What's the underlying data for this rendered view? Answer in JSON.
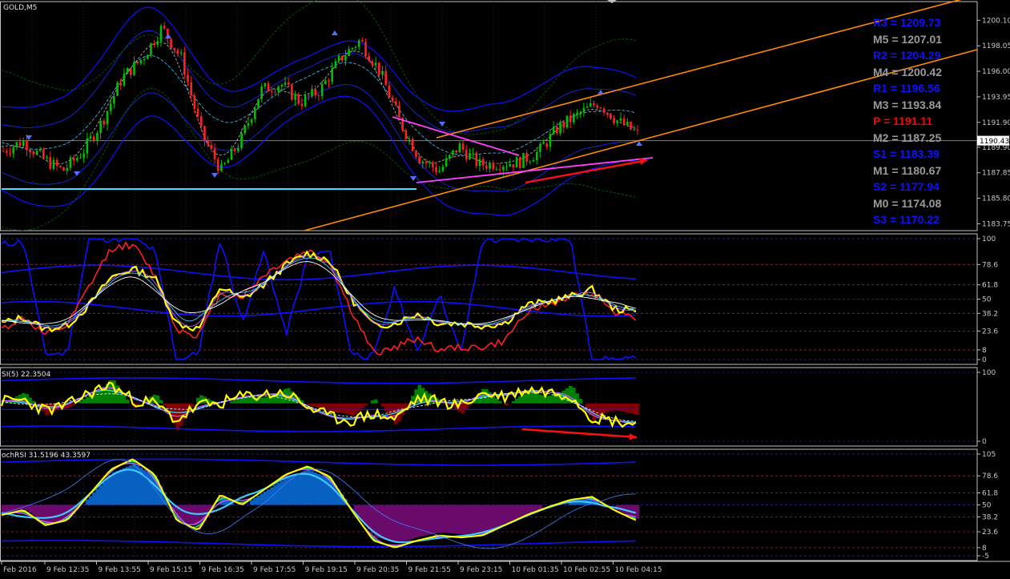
{
  "window": {
    "title": "GOLD,M5"
  },
  "colors": {
    "background": "#000000",
    "frame": "#c0c0c0",
    "bull": "#00c000",
    "bear": "#ff2020",
    "trend": "#ff8c00",
    "magenta": "#ff40ff",
    "blue": "#1010ff",
    "yellow": "#ffff00",
    "cyan": "#40c8ff",
    "histGreen": "#008000",
    "histRed": "#800000",
    "histBlue": "#0860c0",
    "histPurple": "#6a0a6a",
    "pivotBlue": "#1010ff",
    "pivotGray": "#9a9a9a",
    "pivotRed": "#ff0000"
  },
  "chart_data": [
    {
      "type": "candlestick",
      "symbol": "GOLD",
      "timeframe": "M5",
      "x_labels": [
        "Feb 2016",
        "9 Feb 12:35",
        "9 Feb 13:55",
        "9 Feb 15:15",
        "9 Feb 16:35",
        "9 Feb 17:55",
        "9 Feb 19:15",
        "9 Feb 20:35",
        "9 Feb 21:55",
        "9 Feb 23:15",
        "10 Feb 01:35",
        "10 Feb 02:55",
        "10 Feb 04:15"
      ],
      "price_scale_ticks": [
        "1200.10",
        "1198.05",
        "1196.00",
        "1193.95",
        "1191.90",
        "1189.90",
        "1187.85",
        "1185.80",
        "1183.75"
      ],
      "ylim": [
        1183.2,
        1201.6
      ],
      "current_price": "1190.43",
      "close_path": [
        1189.6,
        1190.4,
        1189.0,
        1188.0,
        1189.5,
        1192.0,
        1195.5,
        1197.0,
        1199.5,
        1197.0,
        1191.0,
        1188.0,
        1190.5,
        1194.5,
        1195.0,
        1193.5,
        1194.5,
        1197.0,
        1198.5,
        1196.0,
        1192.0,
        1189.0,
        1188.0,
        1190.0,
        1188.5,
        1188.6,
        1188.7,
        1189.5,
        1191.5,
        1192.5,
        1193.5,
        1192.0,
        1191.0
      ],
      "pivot_levels": [
        {
          "label": "R3 = 1209.73",
          "color": "#1010ff"
        },
        {
          "label": "M5 = 1207.01",
          "color": "#9a9a9a"
        },
        {
          "label": "R2 = 1204.29",
          "color": "#1010ff"
        },
        {
          "label": "M4 = 1200.42",
          "color": "#9a9a9a"
        },
        {
          "label": "R1 = 1196.56",
          "color": "#1010ff"
        },
        {
          "label": "M3 = 1193.84",
          "color": "#9a9a9a"
        },
        {
          "label": "P   = 1191.11",
          "color": "#ff0000"
        },
        {
          "label": "M2 = 1187.25",
          "color": "#9a9a9a"
        },
        {
          "label": "S1 = 1183.39",
          "color": "#1010ff"
        },
        {
          "label": "M1 = 1180.67",
          "color": "#9a9a9a"
        },
        {
          "label": "S2 = 1177.94",
          "color": "#1010ff"
        },
        {
          "label": "M0 = 1174.08",
          "color": "#9a9a9a"
        },
        {
          "label": "S3 = 1170.22",
          "color": "#1010ff"
        }
      ]
    },
    {
      "type": "line",
      "panel": "oscillator-1",
      "ylim": [
        0,
        100
      ],
      "levels": [
        "100",
        "78.6",
        "61.8",
        "50",
        "38.2",
        "23.6",
        "8",
        "0"
      ],
      "series": [
        {
          "color": "#ffff00",
          "values": [
            30,
            35,
            25,
            28,
            45,
            68,
            75,
            68,
            30,
            25,
            60,
            50,
            62,
            78,
            88,
            82,
            50,
            28,
            30,
            38,
            30,
            30,
            28,
            30,
            45,
            48,
            52,
            58,
            42,
            40
          ]
        },
        {
          "color": "#ff2020",
          "values": [
            25,
            35,
            20,
            28,
            60,
            92,
            95,
            70,
            25,
            20,
            55,
            52,
            70,
            82,
            90,
            80,
            40,
            5,
            10,
            18,
            8,
            10,
            10,
            15,
            40,
            45,
            52,
            56,
            40,
            35
          ]
        },
        {
          "color": "#1010ff",
          "values": [
            95,
            98,
            5,
            5,
            100,
            100,
            100,
            90,
            0,
            5,
            100,
            30,
            90,
            20,
            85,
            90,
            5,
            2,
            60,
            5,
            55,
            5,
            100,
            98,
            100,
            100,
            100,
            0,
            0,
            0
          ]
        }
      ]
    },
    {
      "type": "line",
      "panel": "rsi",
      "label": "SI(5) 22.3504",
      "ylim": [
        0,
        100
      ],
      "levels": [
        "100",
        "0"
      ],
      "series": [
        {
          "color": "#ffff00",
          "values": [
            58,
            60,
            45,
            52,
            70,
            82,
            60,
            55,
            30,
            52,
            55,
            65,
            68,
            70,
            50,
            35,
            30,
            40,
            32,
            62,
            58,
            52,
            70,
            65,
            75,
            72,
            68,
            35,
            30,
            25
          ]
        }
      ]
    },
    {
      "type": "line",
      "panel": "stochrsi",
      "label": "ochRSI 31.5196 43.3597",
      "ylim": [
        0,
        100
      ],
      "levels": [
        "100",
        "78.6",
        "61.8",
        "50",
        "38.2",
        "23.6",
        "8",
        "0"
      ],
      "series": [
        {
          "color": "#ffff00",
          "values": [
            40,
            45,
            30,
            35,
            60,
            85,
            95,
            80,
            35,
            25,
            60,
            50,
            65,
            80,
            88,
            78,
            45,
            15,
            8,
            15,
            20,
            18,
            20,
            30,
            40,
            48,
            55,
            58,
            45,
            35
          ]
        },
        {
          "color": "#40c8ff",
          "values": [
            35,
            40,
            38,
            40,
            50,
            65,
            78,
            80,
            60,
            45,
            50,
            52,
            58,
            68,
            78,
            75,
            55,
            30,
            18,
            18,
            22,
            22,
            25,
            32,
            40,
            45,
            52,
            55,
            50,
            44
          ]
        }
      ]
    }
  ],
  "osc1": {
    "ticks": [
      "100",
      "78.6",
      "61.8",
      "50",
      "38.2",
      "23.6",
      "8",
      "0"
    ]
  },
  "rsi": {
    "ticks": [
      "100",
      "0"
    ]
  },
  "stoch": {
    "ticks": [
      "105",
      "78.6",
      "61.8",
      "50",
      "38.2",
      "23.6",
      "8",
      "-5"
    ]
  }
}
